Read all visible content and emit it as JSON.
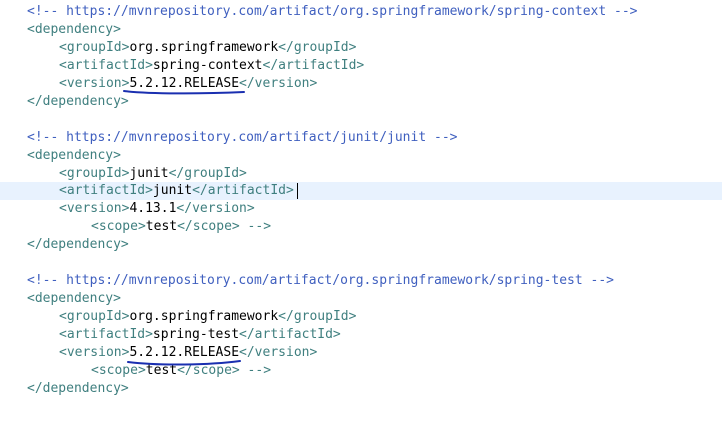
{
  "editor": {
    "lines": [
      {
        "kind": "comment",
        "text": "<!-- https://mvnrepository.com/artifact/org.springframework/spring-context -->"
      },
      {
        "kind": "tag",
        "text": "<dependency>"
      },
      {
        "kind": "elem",
        "open": "<groupId>",
        "value": "org.springframework",
        "close": "</groupId>"
      },
      {
        "kind": "elem",
        "open": "<artifactId>",
        "value": "spring-context",
        "close": "</artifactId>"
      },
      {
        "kind": "elem",
        "open": "<version>",
        "value": "5.2.12.RELEASE",
        "close": "</version>"
      },
      {
        "kind": "tag",
        "text": "</dependency>"
      },
      {
        "kind": "blank",
        "text": ""
      },
      {
        "kind": "comment",
        "text": "<!-- https://mvnrepository.com/artifact/junit/junit -->"
      },
      {
        "kind": "tag",
        "text": "<dependency>"
      },
      {
        "kind": "elem",
        "open": "<groupId>",
        "value": "junit",
        "close": "</groupId>"
      },
      {
        "kind": "elem",
        "open": "<artifactId>",
        "value": "junit",
        "close": "</artifactId>"
      },
      {
        "kind": "elem",
        "open": "<version>",
        "value": "4.13.1",
        "close": "</version>"
      },
      {
        "kind": "elem",
        "open": "<scope>",
        "value": "test",
        "close": "</scope> -->"
      },
      {
        "kind": "tag",
        "text": "</dependency>"
      },
      {
        "kind": "blank",
        "text": ""
      },
      {
        "kind": "comment",
        "text": "<!-- https://mvnrepository.com/artifact/org.springframework/spring-test -->"
      },
      {
        "kind": "tag",
        "text": "<dependency>"
      },
      {
        "kind": "elem",
        "open": "<groupId>",
        "value": "org.springframework",
        "close": "</groupId>"
      },
      {
        "kind": "elem",
        "open": "<artifactId>",
        "value": "spring-test",
        "close": "</artifactId>"
      },
      {
        "kind": "elem",
        "open": "<version>",
        "value": "5.2.12.RELEASE",
        "close": "</version>"
      },
      {
        "kind": "elem",
        "open": "<scope>",
        "value": "test",
        "close": "</scope> -->"
      },
      {
        "kind": "tag",
        "text": "</dependency>"
      }
    ],
    "current_line": 11
  },
  "colors": {
    "comment": "#3f5fbf",
    "tag": "#3f7f7f",
    "value": "#000000",
    "current_line_bg": "#e8f2fe",
    "annotation_ink": "#1a2fb0"
  }
}
